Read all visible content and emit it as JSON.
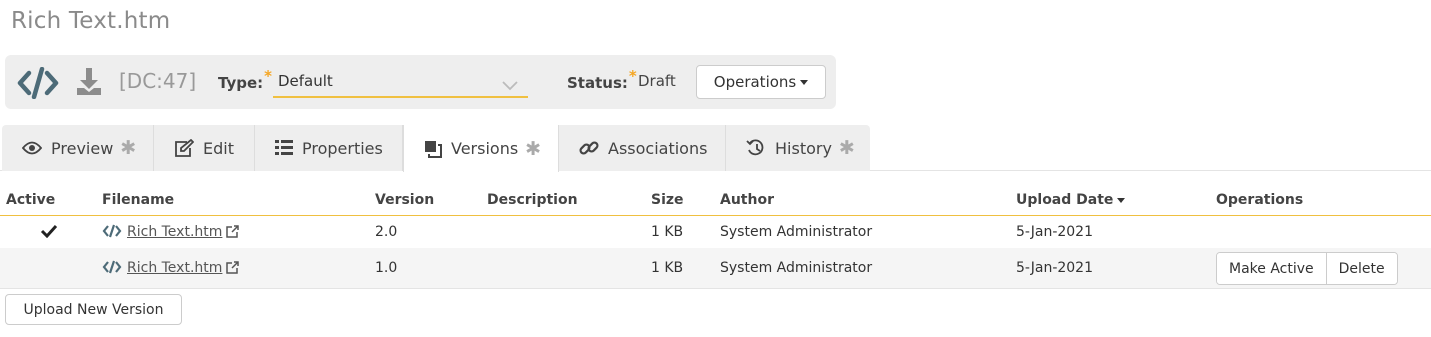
{
  "page": {
    "title": "Rich Text.htm"
  },
  "header": {
    "doc_id": "[DC:47]",
    "type_label": "Type:",
    "type_value": "Default",
    "status_label": "Status:",
    "status_value": "Draft",
    "required_marker": "*",
    "operations_label": "Operations",
    "accent_color": "#f0c040",
    "required_color": "#f5a623"
  },
  "tabs": [
    {
      "label": "Preview",
      "icon": "eye-icon",
      "has_star": true,
      "active": false
    },
    {
      "label": "Edit",
      "icon": "edit-icon",
      "has_star": false,
      "active": false
    },
    {
      "label": "Properties",
      "icon": "list-icon",
      "has_star": false,
      "active": false
    },
    {
      "label": "Versions",
      "icon": "versions-icon",
      "has_star": true,
      "active": true
    },
    {
      "label": "Associations",
      "icon": "link-icon",
      "has_star": false,
      "active": false
    },
    {
      "label": "History",
      "icon": "history-icon",
      "has_star": true,
      "active": false
    }
  ],
  "tab_star": "✱",
  "table": {
    "columns": {
      "active": "Active",
      "filename": "Filename",
      "version": "Version",
      "description": "Description",
      "size": "Size",
      "author": "Author",
      "upload_date": "Upload Date",
      "operations": "Operations"
    },
    "sorted_by": "upload_date",
    "rows": [
      {
        "active": true,
        "filename": "Rich Text.htm",
        "version": "2.0",
        "description": "",
        "size": "1 KB",
        "author": "System Administrator",
        "upload_date": "5-Jan-2021",
        "operations": []
      },
      {
        "active": false,
        "filename": "Rich Text.htm",
        "version": "1.0",
        "description": "",
        "size": "1 KB",
        "author": "System Administrator",
        "upload_date": "5-Jan-2021",
        "operations": [
          "Make Active",
          "Delete"
        ]
      }
    ]
  },
  "upload_button": "Upload New Version"
}
